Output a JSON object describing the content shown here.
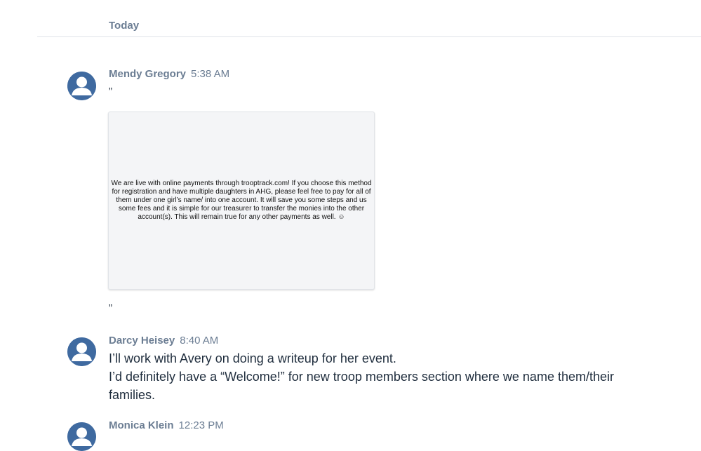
{
  "day_divider": "Today",
  "messages": [
    {
      "author": "Mendy Gregory",
      "time": "5:38 AM",
      "quote_open": "”",
      "attachment_text": "We are live with online payments through trooptrack.com!  If you choose this method for registration and have multiple daughters in AHG, please feel free to pay for all of them under one girl’s name/ into one account.  It will save you some steps and us some fees and it is simple for our treasurer to transfer the monies into the other account(s).  This will remain true for any other payments as well. ☺",
      "quote_close": "”"
    },
    {
      "author": "Darcy Heisey",
      "time": "8:40 AM",
      "lines": [
        "I’ll work with Avery on doing a writeup for her event.",
        "I’d definitely have a “Welcome!” for new troop members section where we name them/their families."
      ]
    },
    {
      "author": "Monica Klein",
      "time": "12:23 PM"
    }
  ],
  "colors": {
    "avatar": "#3f6aa0",
    "meta_text": "#6b7d93",
    "body_text": "#1f2d3d"
  }
}
